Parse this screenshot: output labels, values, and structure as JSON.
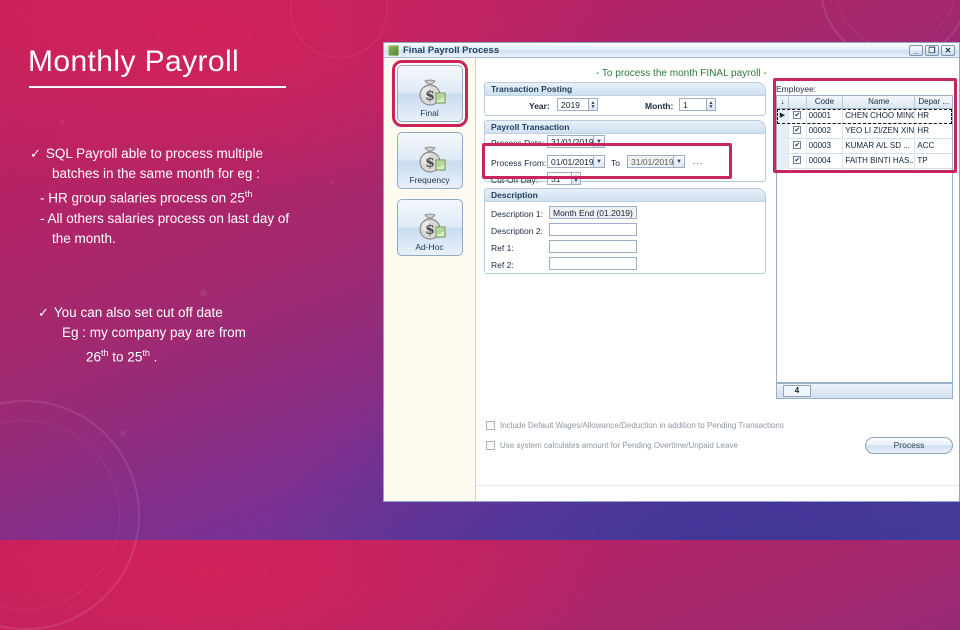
{
  "slide": {
    "title": "Monthly Payroll",
    "bullets": [
      {
        "marker": "✓",
        "lines": [
          "SQL Payroll able to process multiple",
          "batches in the same month for eg :",
          "- HR group salaries process on 25",
          "- All others salaries process on last day of",
          "the month."
        ],
        "sup3": "th"
      },
      {
        "marker": "✓",
        "lines": [
          "You can also set cut off date",
          "Eg :  my company pay are from",
          "26"
        ],
        "tail_a": "th",
        "tail_b": " to 25",
        "tail_c": "th",
        "tail_d": " ."
      }
    ]
  },
  "window": {
    "title": "Final Payroll Process",
    "icon": "app-icon",
    "controls": {
      "minimize": "_",
      "restore": "❐",
      "close": "✕"
    },
    "header_note": "- To process the month FINAL payroll -",
    "rail": [
      {
        "label": "Final",
        "icon": "money-bag-icon",
        "active": true
      },
      {
        "label": "Frequency",
        "icon": "money-bag-icon",
        "active": false
      },
      {
        "label": "Ad-Hoc",
        "icon": "money-bag-icon",
        "active": false
      }
    ],
    "transaction_posting": {
      "caption": "Transaction Posting",
      "year_label": "Year:",
      "year_value": "2019",
      "month_label": "Month:",
      "month_value": "1"
    },
    "payroll_transaction": {
      "caption": "Payroll Transaction",
      "process_date_label": "Process Date:",
      "process_date_value": "31/01/2019",
      "process_from_label": "Process From:",
      "process_from_value": "01/01/2019",
      "to_label": "To",
      "process_to_value": "31/01/2019",
      "ellipsis": "...",
      "cutoff_label": "Cut-Off Day:",
      "cutoff_value": "31"
    },
    "description": {
      "caption": "Description",
      "rows": [
        {
          "label": "Description 1:",
          "value": "Month End (01.2019)"
        },
        {
          "label": "Description 2:",
          "value": ""
        },
        {
          "label": "Ref 1:",
          "value": ""
        },
        {
          "label": "Ref 2:",
          "value": ""
        }
      ]
    },
    "employee": {
      "caption": "Employee:",
      "columns": [
        "↓",
        "",
        "Code",
        "Name",
        "Depar ..."
      ],
      "rows": [
        {
          "indicator": "▶",
          "checked": "✔",
          "code": "00001",
          "name": "CHEN CHOO MING",
          "dept": "HR",
          "selected": true
        },
        {
          "indicator": "",
          "checked": "✔",
          "code": "00002",
          "name": "YEO LI ZI/ZEN XIN",
          "dept": "HR",
          "selected": false
        },
        {
          "indicator": "",
          "checked": "✔",
          "code": "00003",
          "name": "KUMAR A/L SD ...",
          "dept": "ACC",
          "selected": false
        },
        {
          "indicator": "",
          "checked": "✔",
          "code": "00004",
          "name": "FAITH BINTI HAS...",
          "dept": "TP",
          "selected": false
        }
      ],
      "record_count": "4"
    },
    "options": [
      {
        "label": "Include Default Wages/Allowance/Deduction in addition to Pending Transactions",
        "checked": false
      },
      {
        "label": "Use system calculates amount for Pending Overtime/Unpaid Leave",
        "checked": false
      }
    ],
    "process_button": "Process"
  },
  "colors": {
    "highlight": "#c8245e",
    "header_note": "#2f7a3c",
    "title_text": "#ffffff",
    "window_chrome": "#cfe0f1"
  }
}
